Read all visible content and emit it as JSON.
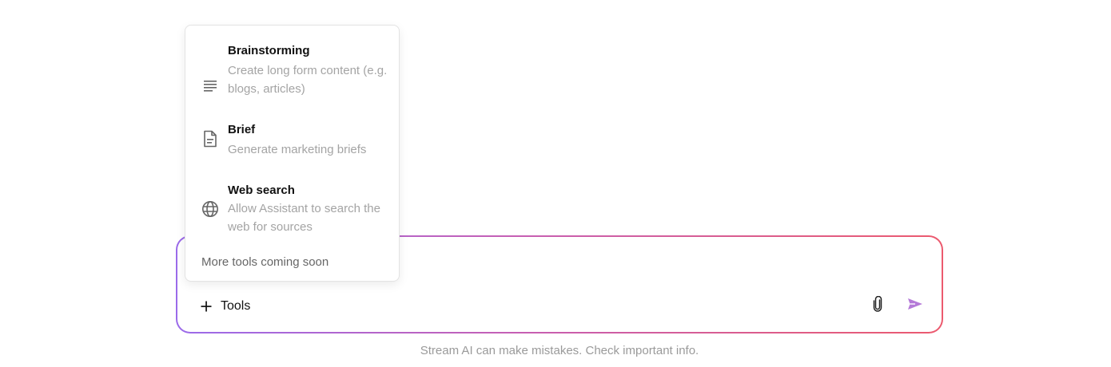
{
  "composer": {
    "input_value": "",
    "tools_label": "Tools",
    "icons": {
      "plus": "plus-icon",
      "attach": "paperclip-icon",
      "send": "send-icon"
    },
    "gradient_colors": [
      "#9b6bea",
      "#c65fb3",
      "#ec5a6e"
    ]
  },
  "tools_menu": {
    "items": [
      {
        "title": "Brainstorming",
        "description": "Create long form content (e.g. blogs, articles)",
        "icon": "lines-icon"
      },
      {
        "title": "Brief",
        "description": "Generate marketing briefs",
        "icon": "document-icon"
      },
      {
        "title": "Web search",
        "description": "Allow Assistant to search the web for sources",
        "icon": "globe-icon"
      }
    ],
    "footer": "More tools coming soon"
  },
  "disclaimer": "Stream AI can make mistakes. Check important info."
}
